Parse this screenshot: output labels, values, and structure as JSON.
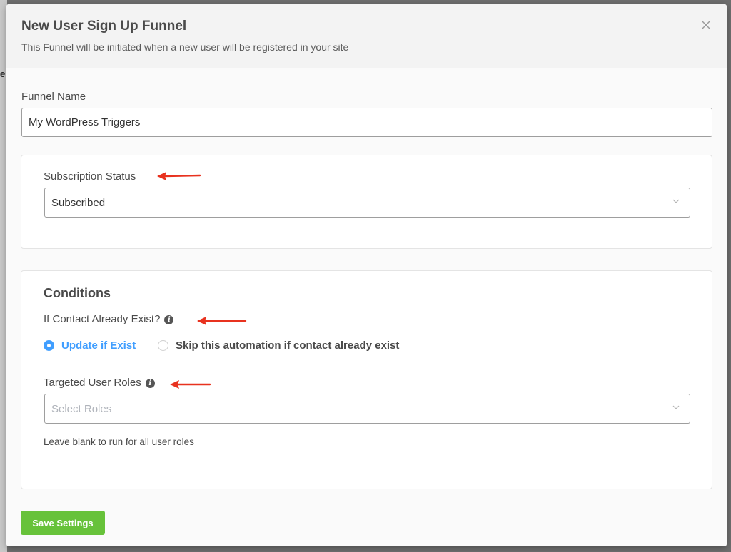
{
  "modal": {
    "title": "New User Sign Up Funnel",
    "subtitle": "This Funnel will be initiated when a new user will be registered in your site",
    "close_icon": "close-icon"
  },
  "funnel_name": {
    "label": "Funnel Name",
    "value": "My WordPress Triggers"
  },
  "subscription": {
    "label": "Subscription Status",
    "selected": "Subscribed"
  },
  "conditions": {
    "title": "Conditions",
    "contact_exist_label": "If Contact Already Exist?",
    "options": [
      {
        "label": "Update if Exist",
        "checked": true
      },
      {
        "label": "Skip this automation if contact already exist",
        "checked": false
      }
    ],
    "roles_label": "Targeted User Roles",
    "roles_placeholder": "Select Roles",
    "roles_help": "Leave blank to run for all user roles"
  },
  "footer": {
    "save_label": "Save Settings"
  },
  "colors": {
    "accent": "#409eff",
    "save": "#67c23a",
    "annotation_arrow": "#e8321f"
  }
}
